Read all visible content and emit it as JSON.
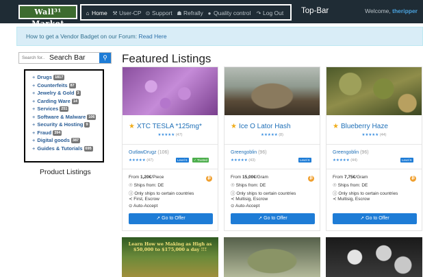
{
  "header": {
    "logo": "Wall³¹ Market",
    "nav": [
      {
        "icon": "home-icon",
        "glyph": "⌂",
        "label": "Home"
      },
      {
        "icon": "wrench-icon",
        "glyph": "⚒",
        "label": "User-CP"
      },
      {
        "icon": "lifebuoy-icon",
        "glyph": "⊙",
        "label": "Support"
      },
      {
        "icon": "trophy-icon",
        "glyph": "☗",
        "label": "Refrally"
      },
      {
        "icon": "badge-icon",
        "glyph": "●",
        "label": "Quality control"
      },
      {
        "icon": "logout-icon",
        "glyph": "↷",
        "label": "Log Out"
      }
    ],
    "topbar_label": "Top-Bar",
    "welcome_prefix": "Welcome,",
    "username": "theripper"
  },
  "banner": {
    "text": "How to get a Vendor Badget on our Forum:",
    "link": "Read Here"
  },
  "sidebar": {
    "search_placeholder": "Search for..",
    "search_label": "Search Bar",
    "categories": [
      {
        "label": "Drugs",
        "count": "1817"
      },
      {
        "label": "Counterfeits",
        "count": "87"
      },
      {
        "label": "Jewelry & Gold",
        "count": "3"
      },
      {
        "label": "Carding Ware",
        "count": "14"
      },
      {
        "label": "Services",
        "count": "251"
      },
      {
        "label": "Software & Malware",
        "count": "106"
      },
      {
        "label": "Security & Hosting",
        "count": "9"
      },
      {
        "label": "Fraud",
        "count": "394"
      },
      {
        "label": "Digital goods",
        "count": "387"
      },
      {
        "label": "Guides & Tutorials",
        "count": "695"
      }
    ],
    "product_listings_label": "Product Listings"
  },
  "main": {
    "heading": "Featured Listings",
    "cards": [
      {
        "title": "XTC TESLA *125mg*",
        "rating_stars": "★★★★★",
        "rating_count": "(47)",
        "vendor": "OutlawDrugz",
        "vendor_count": "(106)",
        "vendor_rating_count": "(47)",
        "level": "Level 5",
        "trusted": "✓ Trusted",
        "price_prefix": "From",
        "price": "1,20€",
        "price_unit": "/Piece",
        "ships_from": "Ships from: DE",
        "ships_to": "Only ships to certain countries",
        "shipping": "First, Escrow",
        "auto_accept": "Auto-Accept",
        "button": "Go to Offer",
        "image_colors": [
          "#8a4f9e",
          "#c58bd8"
        ]
      },
      {
        "title": "Ice O Lator Hash",
        "rating_stars": "★★★★★",
        "rating_count": "(8)",
        "vendor": "Greengoblin",
        "vendor_count": "(96)",
        "vendor_rating_count": "(43)",
        "level": "Level 6",
        "trusted": "",
        "price_prefix": "From",
        "price": "15,00€",
        "price_unit": "/Gram",
        "ships_from": "Ships from: DE",
        "ships_to": "Only ships to certain countries",
        "shipping": "Multisig, Escrow",
        "auto_accept": "Auto-Accept",
        "button": "Go to Offer",
        "image_colors": [
          "#6b5a44",
          "#a8b0a8"
        ]
      },
      {
        "title": "Blueberry Haze",
        "rating_stars": "★★★★★",
        "rating_count": "(44)",
        "vendor": "Greengoblin",
        "vendor_count": "(96)",
        "vendor_rating_count": "(44)",
        "level": "Level 6",
        "trusted": "",
        "price_prefix": "From",
        "price": "7,75€",
        "price_unit": "/Gram",
        "ships_from": "Ships from: DE",
        "ships_to": "Only ships to certain countries",
        "shipping": "Multisig, Escrow",
        "auto_accept": "",
        "button": "Go to Offer",
        "image_colors": [
          "#4d5a2a",
          "#8f8d4a"
        ]
      }
    ],
    "bottom_images": [
      {
        "colors": [
          "#3c6b2a",
          "#a08f3c"
        ],
        "caption": "Learn How we Making as High as $50,000 to $175,000 a day !!!"
      },
      {
        "colors": [
          "#6d7a5c",
          "#b3b99a"
        ],
        "caption": ""
      },
      {
        "colors": [
          "#2a2a2a",
          "#d8d8d8"
        ],
        "caption": ""
      }
    ]
  }
}
